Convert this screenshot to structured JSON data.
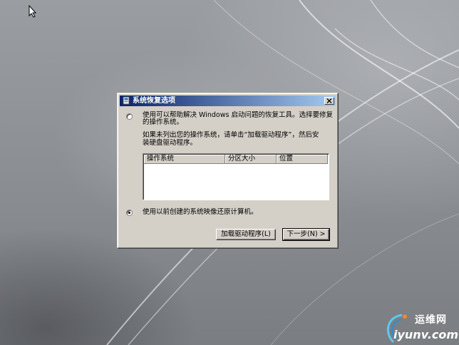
{
  "dialog": {
    "title": "系统恢复选项",
    "option1_line1": "使用可以帮助解决 Windows 启动问题的恢复工具。选择要修复",
    "option1_line2": "的操作系统。",
    "hint_line1": "如果未列出您的操作系统，请单击“加载驱动程序”，然后安",
    "hint_line2": "装硬盘驱动程序。",
    "columns": [
      "操作系统",
      "分区大小",
      "位置"
    ],
    "option2": "使用以前创建的系统映像还原计算机。",
    "selected_option": 2,
    "load_drivers_button": "加载驱动程序(L)",
    "next_button": "下一步(N) >"
  },
  "watermark": {
    "cn": "运维网",
    "en": "iyunv.com"
  }
}
